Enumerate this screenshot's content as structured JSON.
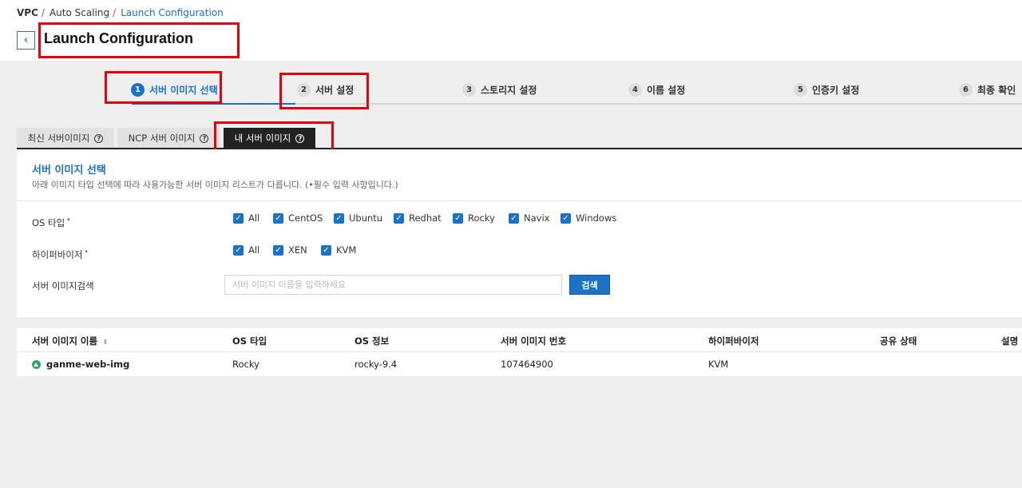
{
  "breadcrumb": {
    "items": [
      "VPC",
      "Auto Scaling"
    ],
    "current": "Launch Configuration",
    "sep": "/"
  },
  "header": {
    "title": "Launch Configuration",
    "back_icon": "‹"
  },
  "steps": [
    {
      "num": "1",
      "label": "서버 이미지 선택",
      "active": true
    },
    {
      "num": "2",
      "label": "서버 설정",
      "active": false
    },
    {
      "num": "3",
      "label": "스토리지 설정",
      "active": false
    },
    {
      "num": "4",
      "label": "이름 설정",
      "active": false
    },
    {
      "num": "5",
      "label": "인증키 설정",
      "active": false
    },
    {
      "num": "6",
      "label": "최종 확인",
      "active": false
    }
  ],
  "tabs": [
    {
      "label": "최신 서버이미지",
      "active": false
    },
    {
      "label": "NCP 서버 이미지",
      "active": false
    },
    {
      "label": "내 서버 이미지",
      "active": true
    }
  ],
  "help_glyph": "?",
  "section": {
    "title": "서버 이미지 선택",
    "desc": "아래 이미지 타입 선택에 따라 사용가능한 서버 이미지 리스트가 다릅니다. (",
    "desc_dot": "•",
    "desc_tail": "필수 입력 사항입니다.)"
  },
  "form": {
    "os_type_label": "OS 타입",
    "os_types": [
      "All",
      "CentOS",
      "Ubuntu",
      "Redhat",
      "Rocky",
      "Navix",
      "Windows"
    ],
    "hypervisor_label": "하이퍼바이저",
    "hypervisors": [
      "All",
      "XEN",
      "KVM"
    ],
    "search_label": "서버 이미지검색",
    "search_placeholder": "서버 이미지 이름을 입력하세요",
    "search_button": "검색",
    "required_dot": "•",
    "check_glyph": "✓"
  },
  "table": {
    "columns": [
      "서버 이미지 이름",
      "OS 타입",
      "OS 정보",
      "서버 이미지 번호",
      "하이퍼바이저",
      "공유 상태",
      "설명"
    ],
    "sort_glyph": "⬍",
    "rows": [
      {
        "name": "ganme-web-img",
        "os_type": "Rocky",
        "os_info": "rocky-9.4",
        "image_no": "107464900",
        "hypervisor": "KVM",
        "share_status": "",
        "description": ""
      }
    ]
  },
  "colors": {
    "accent": "#1a73c8",
    "highlight_box": "#e8000b",
    "status_green": "#2fa36b"
  }
}
